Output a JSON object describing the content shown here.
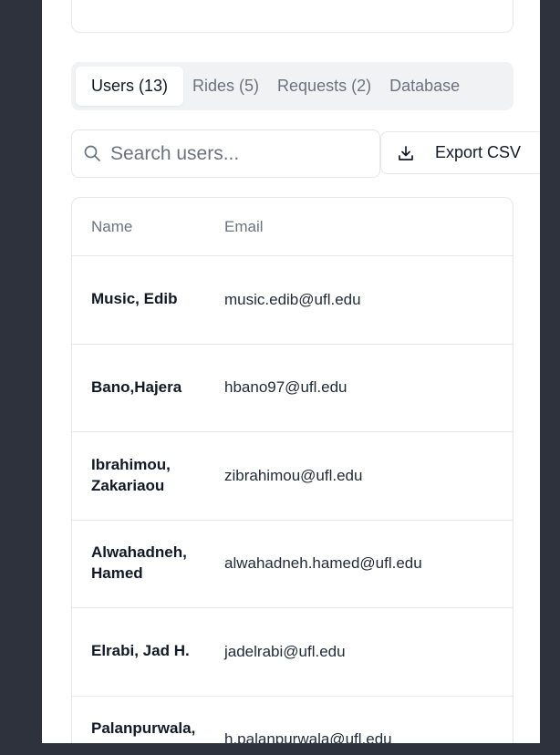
{
  "tabs": [
    {
      "label": "Users (13)",
      "active": true
    },
    {
      "label": "Rides (5)",
      "active": false
    },
    {
      "label": "Requests (2)",
      "active": false
    },
    {
      "label": "Database",
      "active": false
    }
  ],
  "search": {
    "placeholder": "Search users...",
    "icon": "search-icon"
  },
  "export": {
    "label": "Export CSV",
    "icon": "download-icon"
  },
  "table": {
    "headers": {
      "name": "Name",
      "email": "Email"
    },
    "rows": [
      {
        "name": "Music, Edib",
        "email": "music.edib@ufl.edu"
      },
      {
        "name": "Bano,Hajera",
        "email": "hbano97@ufl.edu"
      },
      {
        "name": "Ibrahimou, Zakariaou",
        "email": "zibrahimou@ufl.edu"
      },
      {
        "name": "Alwahadneh, Hamed",
        "email": "alwahadneh.hamed@ufl.edu"
      },
      {
        "name": "Elrabi, Jad H.",
        "email": "jadelrabi@ufl.edu"
      },
      {
        "name": "Palanpurwala, Hussain",
        "email": "h.palanpurwala@ufl.edu"
      }
    ]
  },
  "colors": {
    "backdrop": "#2d323d",
    "panel": "#ffffff",
    "border": "#e5e7eb",
    "tab_bar": "#f1f2f4",
    "muted_text": "#6b7280"
  }
}
